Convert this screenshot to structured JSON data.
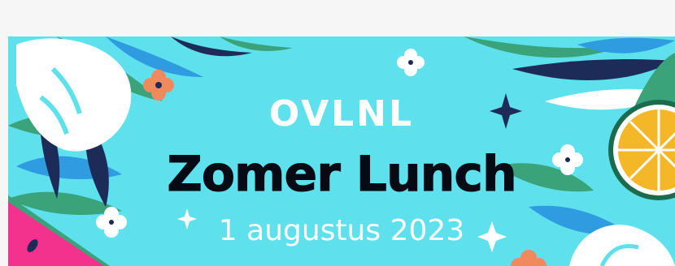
{
  "banner": {
    "brand": "OVLNL",
    "title": "Zomer Lunch",
    "date": "1 augustus 2023"
  },
  "colors": {
    "background": "#5ee1ec",
    "title": "#050a14",
    "text_light": "#ffffff",
    "leaf_dark": "#1c2b57",
    "leaf_green": "#3aa37a",
    "leaf_blue": "#2f9be0",
    "flower_orange": "#f08a5d",
    "watermelon": "#f2328c",
    "citrus": "#f4b728"
  },
  "icons": [
    "monstera-leaf-icon",
    "palm-leaf-icon",
    "flower-icon",
    "sparkle-icon",
    "lemon-slice-icon",
    "watermelon-slice-icon"
  ]
}
